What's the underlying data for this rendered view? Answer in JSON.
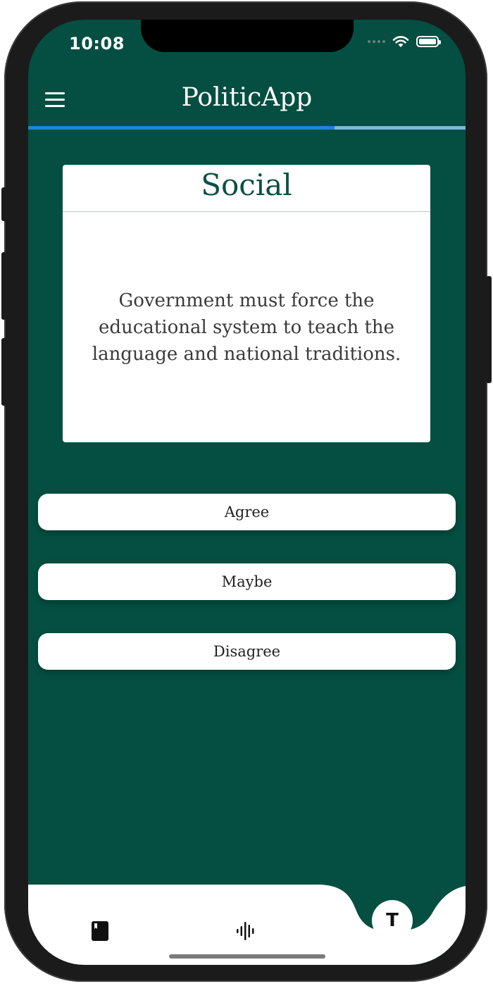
{
  "status_bar": {
    "time": "10:08",
    "icons": [
      "signal-dots-icon",
      "wifi-icon",
      "battery-icon"
    ]
  },
  "header": {
    "title": "PoliticApp",
    "menu_icon": "hamburger-menu-icon"
  },
  "progress": {
    "fraction": 0.7
  },
  "question_card": {
    "category": "Social",
    "statement": "Government must force the educational system to teach the language and national traditions."
  },
  "answers": [
    {
      "label": "Agree"
    },
    {
      "label": "Maybe"
    },
    {
      "label": "Disagree"
    }
  ],
  "tab_bar": {
    "items": [
      {
        "icon": "book-icon"
      },
      {
        "icon": "audio-waveform-icon"
      }
    ],
    "fab_label": "T"
  },
  "colors": {
    "background": "#044f41",
    "card_title": "#0b5143",
    "progress_fill": "#1b86d6",
    "progress_track": "#7fb6d9"
  }
}
